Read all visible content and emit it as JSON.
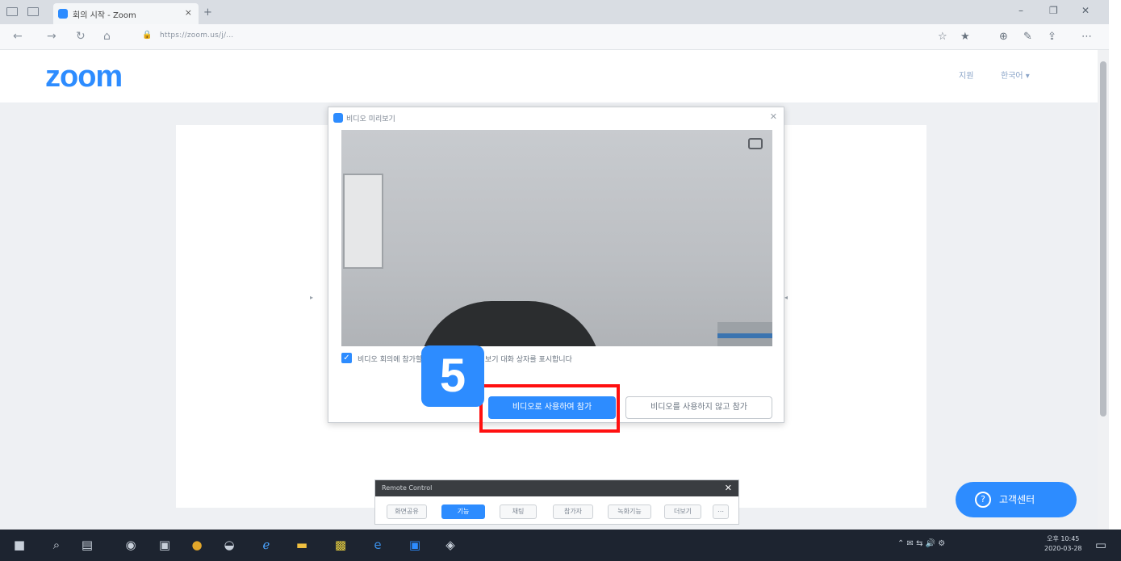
{
  "browser": {
    "tab_title": "회의 시작 - Zoom",
    "tab_close": "×",
    "new_tab": "+",
    "min": "–",
    "max": "❐",
    "close": "✕",
    "back": "←",
    "forward": "→",
    "refresh": "↻",
    "home": "⌂",
    "url": "https://zoom.us/j/...",
    "toolbar": [
      "☆",
      "★",
      "⊕",
      "✎",
      "⇪",
      "⋯"
    ]
  },
  "header": {
    "logo": "zoom",
    "help": "지원",
    "language": "한국어 ▾"
  },
  "dialog": {
    "title": "비디오 미리보기",
    "close": "✕",
    "checkbox_checked": true,
    "checkbox_mark": "✓",
    "checkbox_label": "비디오 회의에 참가할 때 항상 비디오 미리보기 대화 상자를 표시합니다",
    "join_with_video": "비디오로 사용하여 참가",
    "join_without_video": "비디오를 사용하지 않고 참가"
  },
  "annotation": {
    "step_number": "5"
  },
  "remote_bar": {
    "title": "Remote Control",
    "close": "✕",
    "buttons": [
      "화면공유",
      "기능",
      "채팅",
      "참가자",
      "녹화기능",
      "더보기",
      "⋯"
    ],
    "active_index": 1
  },
  "support": {
    "icon": "?",
    "label": "고객센터"
  },
  "taskbar": {
    "tray": "⌃  ✉  ⇆  🔊  ⚙",
    "time": "오후 10:45",
    "date": "2020-03-28"
  },
  "colors": {
    "zoom_blue": "#2d8cff",
    "annotation_red": "#ff1010"
  }
}
